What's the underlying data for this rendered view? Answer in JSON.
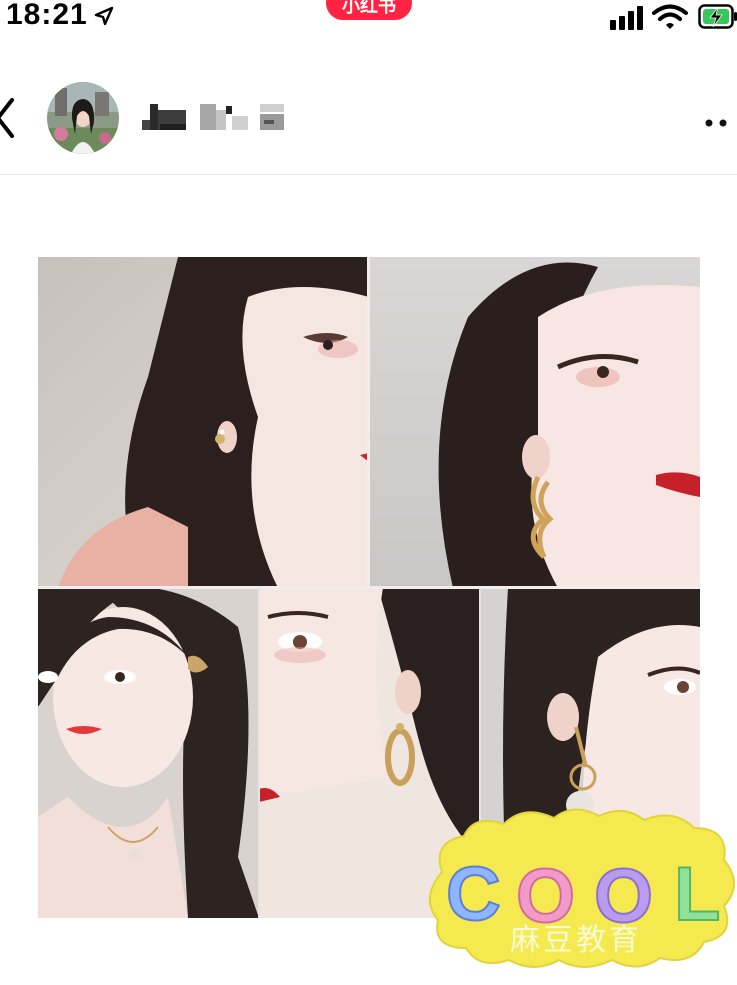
{
  "status_bar": {
    "time": "18:21",
    "app_badge": "小红书"
  },
  "header": {
    "username": ""
  },
  "post": {
    "sticker_text": "COOL",
    "watermark": "麻豆教育"
  },
  "colors": {
    "brand": "#ff2442",
    "battery": "#34c759"
  }
}
